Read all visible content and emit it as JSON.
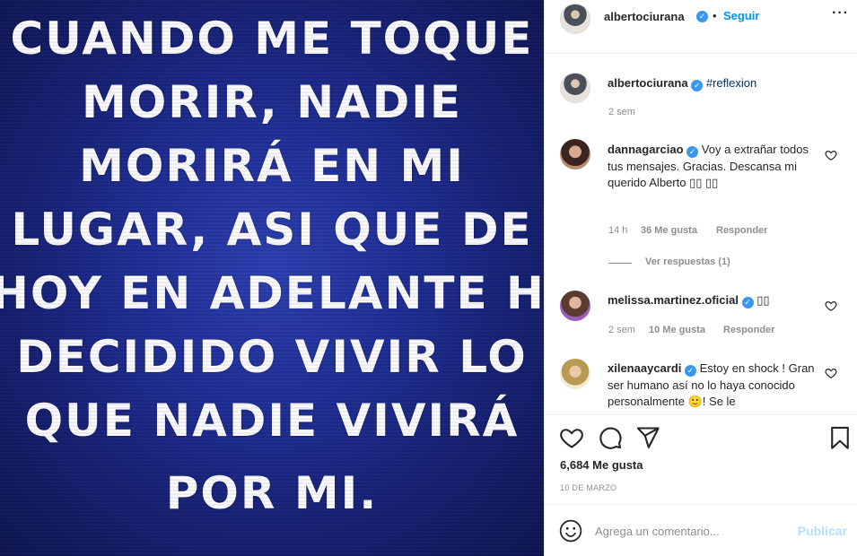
{
  "post": {
    "quote_lines": [
      "CUANDO ME TOQUE",
      "MORIR, NADIE",
      "MORIRÁ EN MI",
      "LUGAR, ASI QUE DE",
      "HOY EN ADELANTE HE",
      "DECIDIDO VIVIR LO",
      "QUE NADIE VIVIRÁ",
      "POR MI."
    ]
  },
  "header": {
    "username": "albertociurana",
    "separator": "•",
    "follow_label": "Seguir",
    "more_icon": "more-horizontal-icon"
  },
  "caption": {
    "username": "albertociurana",
    "hashtag": "#reflexion",
    "time": "2 sem"
  },
  "comments": [
    {
      "username": "dannagarciao",
      "text": "Voy a extrañar todos tus mensajes. Gracias. Descansa mi querido Alberto ▯▯ ▯▯",
      "time": "14 h",
      "likes": "36 Me gusta",
      "reply_label": "Responder",
      "view_replies": "Ver respuestas (1)"
    },
    {
      "username": "melissa.martinez.oficial",
      "text": "▯▯",
      "time": "2 sem",
      "likes": "10 Me gusta",
      "reply_label": "Responder"
    },
    {
      "username": "xilenaaycardi",
      "text": "Estoy en shock ! Gran ser humano así no lo haya conocido personalmente 🙂! Se le",
      "emoji": "slightly-smiling-face"
    }
  ],
  "stats": {
    "likes": "6,684 Me gusta",
    "date": "10 DE MARZO"
  },
  "add_comment": {
    "placeholder": "Agrega un comentario...",
    "publish_label": "Publicar"
  },
  "colors": {
    "verified": "#3897f0",
    "follow": "#0095f6",
    "publish_disabled": "#b2dffc",
    "post_background": "#1f2e95"
  }
}
